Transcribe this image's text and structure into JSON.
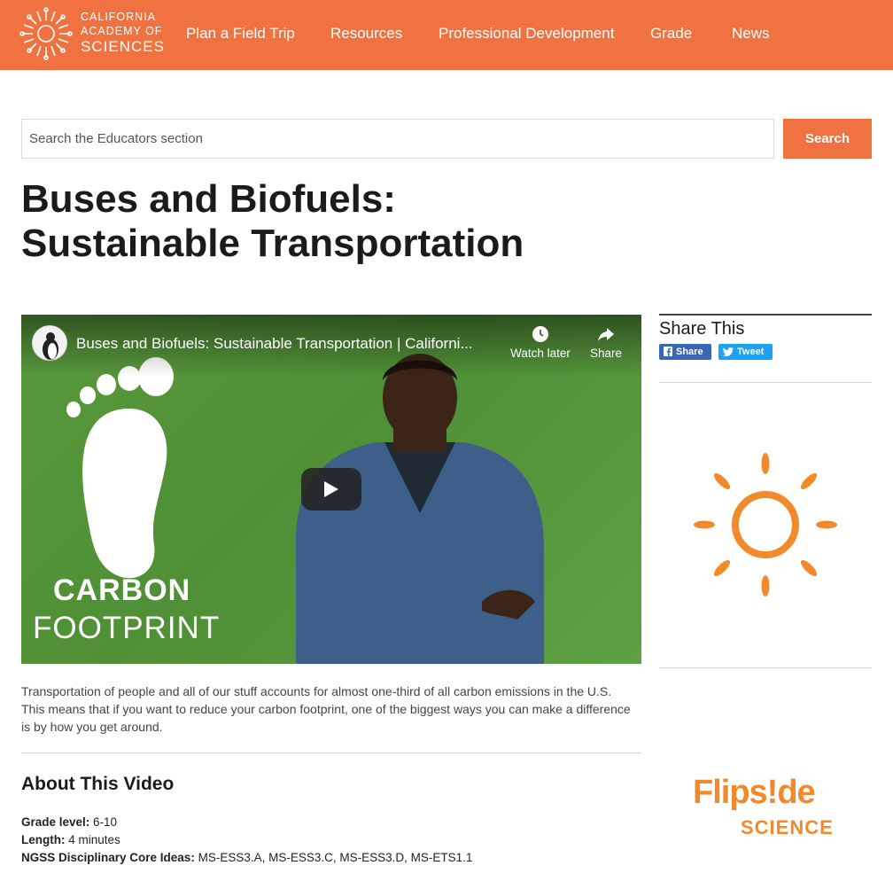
{
  "header": {
    "logo": {
      "line1": "CALIFORNIA",
      "line2": "ACADEMY OF",
      "line3": "SCIENCES"
    },
    "nav": [
      "Plan a Field Trip",
      "Resources",
      "Professional Development",
      "Grade",
      "News"
    ]
  },
  "search": {
    "placeholder": "Search the Educators section",
    "button_label": "Search"
  },
  "page": {
    "title_line1": "Buses and Biofuels:",
    "title_line2": "Sustainable Transportation"
  },
  "video": {
    "title": "Buses and Biofuels: Sustainable Transportation | Californi...",
    "watch_later": "Watch later",
    "share": "Share",
    "overlay_line1": "CARBON",
    "overlay_line2": "FOOTPRINT"
  },
  "description": "Transportation of people and all of our stuff accounts for almost one-third of all carbon emissions in the U.S. This means that if you want to reduce your carbon footprint, one of the biggest ways you can make a difference is by how you get around.",
  "about": {
    "heading": "About This Video",
    "grade_label": "Grade level:",
    "grade_value": " 6-10",
    "length_label": "Length:",
    "length_value": " 4 minutes",
    "ngss_label": "NGSS Disciplinary Core Ideas:",
    "ngss_value": " MS-ESS3.A, MS-ESS3.C, MS-ESS3.D, MS-ETS1.1"
  },
  "sidebar": {
    "share_title": "Share This",
    "facebook_label": "Share",
    "twitter_label": "Tweet",
    "flipside_line1": "Flips!de",
    "flipside_line2": "SCIENCE"
  },
  "colors": {
    "brand_orange": "#f07240",
    "flipside_orange": "#f28a2c",
    "facebook_blue": "#3b65b7",
    "twitter_blue": "#1da1f2"
  }
}
